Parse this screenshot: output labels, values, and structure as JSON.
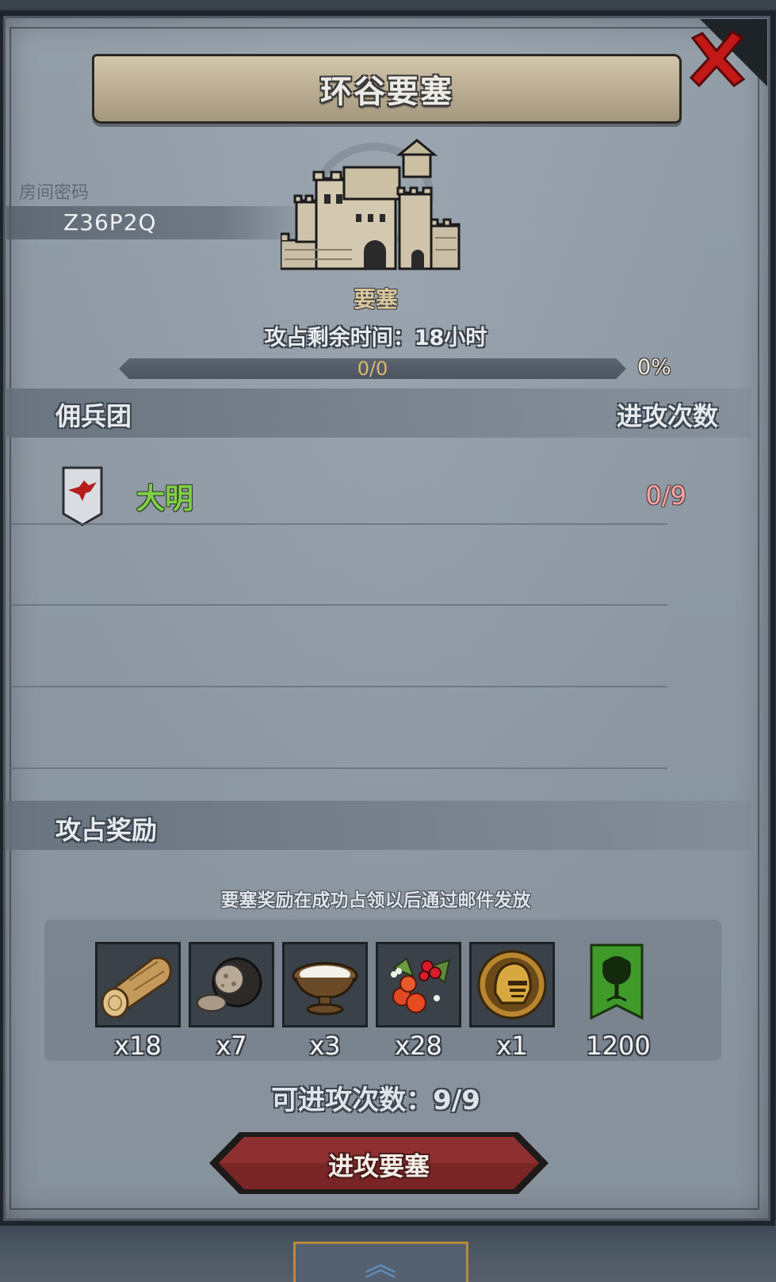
{
  "title": "环谷要塞",
  "room": {
    "label": "房间密码",
    "code": "Z36P2Q"
  },
  "fortress": {
    "icon": "castle-icon",
    "label": "要塞",
    "remaining_time": "攻占剩余时间：18小时",
    "progress_text": "0/0",
    "progress_fraction": 0,
    "progress_percent": "0%"
  },
  "mercenary_section": {
    "title": "佣兵团",
    "attempts_header": "进攻次数",
    "rows": [
      {
        "badge_icon": "red-bird-shield-icon",
        "name": "大明",
        "attempts": "0/9",
        "name_color": "#7fcf46",
        "attempts_color": "#f2a6a6"
      }
    ]
  },
  "rewards_section": {
    "title": "攻占奖励",
    "note": "要塞奖励在成功占领以后通过邮件发放",
    "items": [
      {
        "icon": "wood-log-icon",
        "qty": "x18"
      },
      {
        "icon": "truffle-icon",
        "qty": "x7"
      },
      {
        "icon": "milk-bowl-icon",
        "qty": "x3"
      },
      {
        "icon": "berries-icon",
        "qty": "x28"
      },
      {
        "icon": "knight-helmet-coin-icon",
        "qty": "x1"
      },
      {
        "icon": "green-tree-banner-icon",
        "qty": "1200"
      }
    ]
  },
  "attack_count": "可进攻次数：9/9",
  "attack_button": "进攻要塞",
  "close_icon": "close-icon",
  "colors": {
    "panel_bg": "#8f9aa4",
    "title_banner": "#c2b59a",
    "button_red": "#7a2525",
    "close_red": "#c21818"
  }
}
